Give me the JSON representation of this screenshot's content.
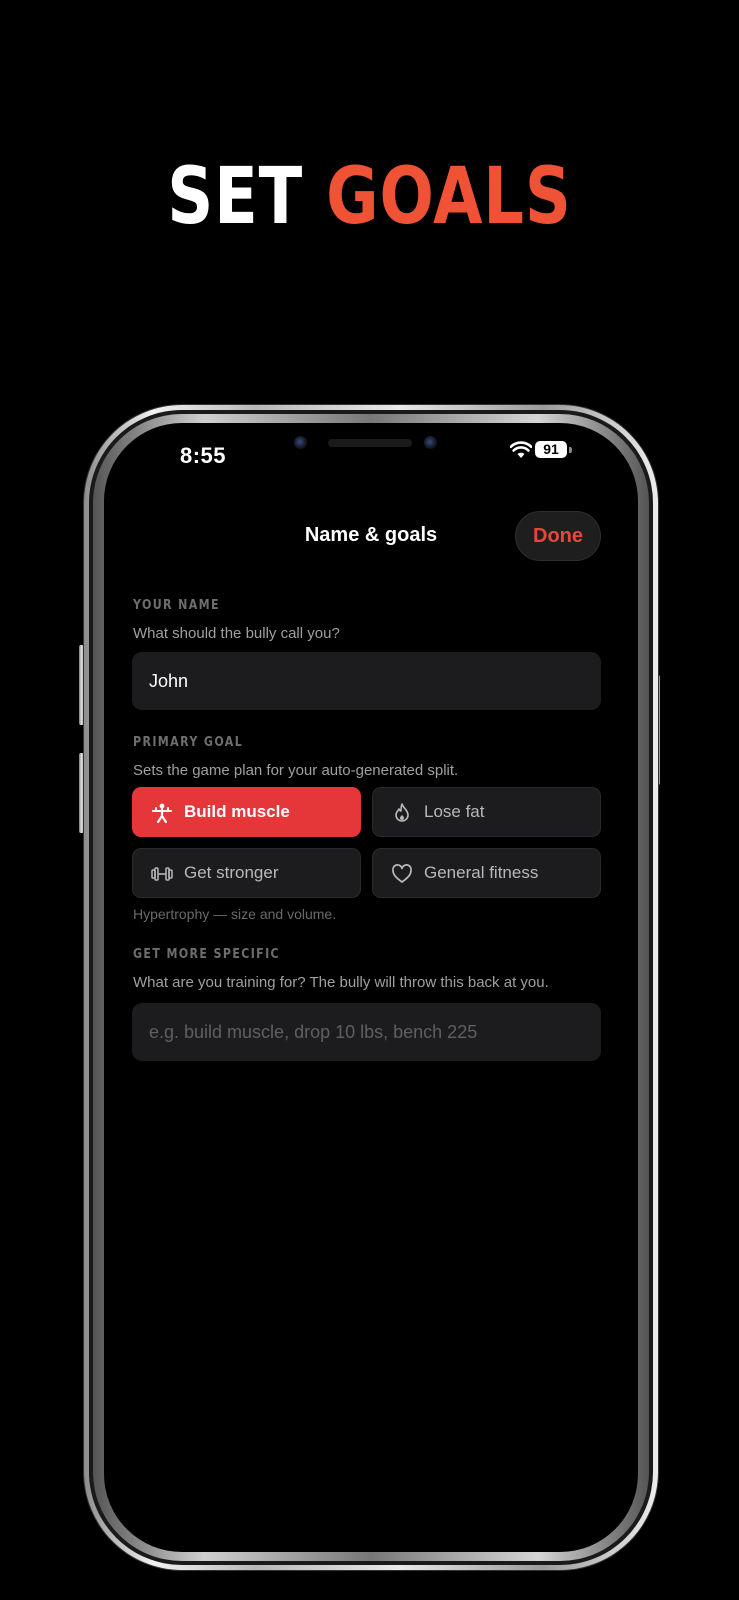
{
  "headline": {
    "word1": "SET",
    "word2": "GOALS"
  },
  "status_bar": {
    "time": "8:55",
    "battery": "91"
  },
  "nav": {
    "title": "Name & goals",
    "done_label": "Done"
  },
  "name_section": {
    "label": "YOUR NAME",
    "description": "What should the bully call you?",
    "value": "John"
  },
  "goal_section": {
    "label": "PRIMARY GOAL",
    "description": "Sets the game plan for your auto-generated split.",
    "options": [
      {
        "label": "Build muscle",
        "icon": "person-lifting-icon",
        "selected": true
      },
      {
        "label": "Lose fat",
        "icon": "flame-icon",
        "selected": false
      },
      {
        "label": "Get stronger",
        "icon": "dumbbell-icon",
        "selected": false
      },
      {
        "label": "General fitness",
        "icon": "heart-icon",
        "selected": false
      }
    ],
    "hint": "Hypertrophy — size and volume."
  },
  "specific_section": {
    "label": "GET MORE SPECIFIC",
    "description": "What are you training for? The bully will throw this back at you.",
    "placeholder": "e.g. build muscle, drop 10 lbs, bench 225"
  },
  "colors": {
    "accent": "#e5363a",
    "headline_accent": "#ef5235",
    "background": "#000000",
    "field": "#1c1c1e"
  }
}
